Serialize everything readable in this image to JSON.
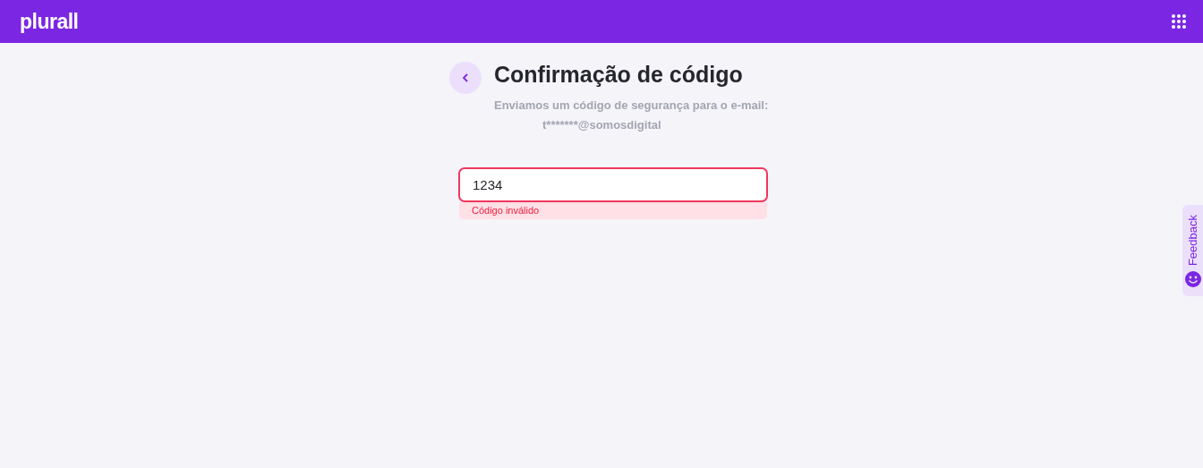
{
  "header": {
    "logo": "plurall"
  },
  "page": {
    "title": "Confirmação de código",
    "subtitle": "Enviamos um código de segurança para o e-mail:",
    "email": "t*******@somosdigital"
  },
  "code_field": {
    "value": "1234",
    "invalid": true,
    "error": "Código inválido"
  },
  "feedback_tab": {
    "label": "Feedback"
  }
}
